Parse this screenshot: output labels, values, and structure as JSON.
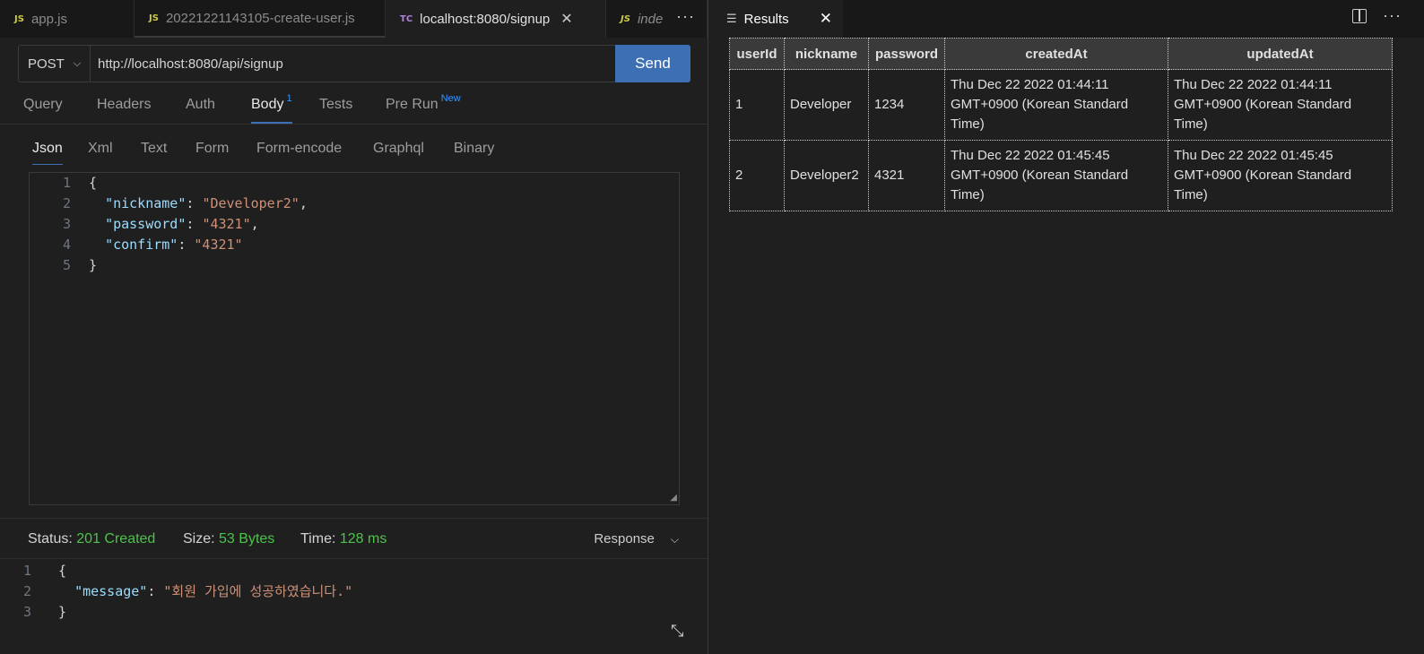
{
  "editor_tabs": [
    {
      "badge": "JS",
      "label": "app.js"
    },
    {
      "badge": "JS",
      "label": "20221221143105-create-user.js"
    },
    {
      "badge": "TC",
      "label": "localhost:8080/signup"
    },
    {
      "badge": "JS",
      "label": "inde"
    }
  ],
  "request": {
    "method": "POST",
    "url": "http://localhost:8080/api/signup",
    "send_label": "Send"
  },
  "request_tabs": {
    "query": "Query",
    "headers": "Headers",
    "auth": "Auth",
    "body": "Body",
    "body_count": "1",
    "tests": "Tests",
    "prerun": "Pre Run",
    "prerun_badge": "New"
  },
  "body_tabs": [
    "Json",
    "Xml",
    "Text",
    "Form",
    "Form-encode",
    "Graphql",
    "Binary"
  ],
  "body_code": {
    "ln": [
      "1",
      "2",
      "3",
      "4",
      "5"
    ],
    "open": "{",
    "nickname_key": "\"nickname\"",
    "nickname_val": "\"Developer2\"",
    "password_key": "\"password\"",
    "password_val": "\"4321\"",
    "confirm_key": "\"confirm\"",
    "confirm_val": "\"4321\"",
    "close": "}"
  },
  "status": {
    "status_label": "Status:",
    "status_value": "201 Created",
    "size_label": "Size:",
    "size_value": "53 Bytes",
    "time_label": "Time:",
    "time_value": "128 ms",
    "response_label": "Response"
  },
  "response_code": {
    "ln": [
      "1",
      "2",
      "3"
    ],
    "open": "{",
    "message_key": "\"message\"",
    "message_val": "\"회원 가입에 성공하였습니다.\"",
    "close": "}"
  },
  "results_panel": {
    "tab_label": "Results",
    "columns": [
      "userId",
      "nickname",
      "password",
      "createdAt",
      "updatedAt"
    ],
    "rows": [
      [
        "1",
        "Developer",
        "1234",
        "Thu Dec 22 2022 01:44:11 GMT+0900 (Korean Standard Time)",
        "Thu Dec 22 2022 01:44:11 GMT+0900 (Korean Standard Time)"
      ],
      [
        "2",
        "Developer2",
        "4321",
        "Thu Dec 22 2022 01:45:45 GMT+0900 (Korean Standard Time)",
        "Thu Dec 22 2022 01:45:45 GMT+0900 (Korean Standard Time)"
      ]
    ]
  },
  "colors": {
    "accent": "#3d6fb4",
    "status_ok": "#4ec24b",
    "json_key": "#9cdcfe",
    "json_string": "#ce9178"
  }
}
